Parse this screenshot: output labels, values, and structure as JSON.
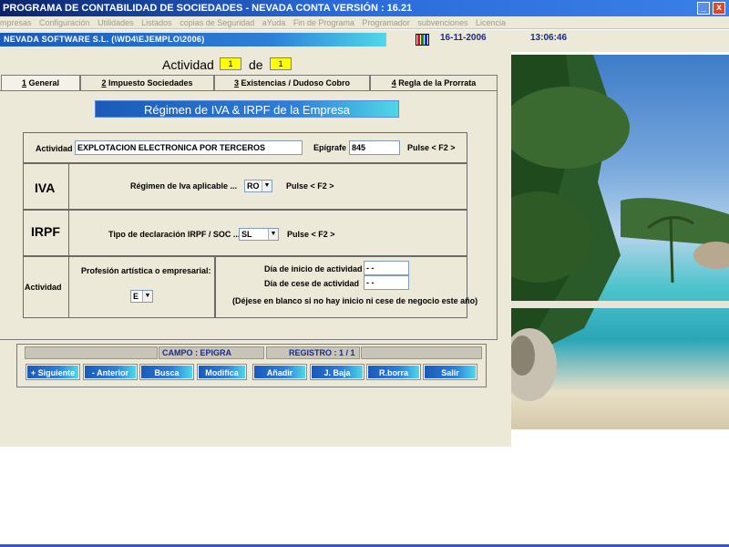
{
  "window": {
    "title": "PROGRAMA DE CONTABILIDAD DE SOCIEDADES - NEVADA CONTA  VERSIÓN : 16.21",
    "minimize": "_",
    "close": "x"
  },
  "menu": [
    "mpresas",
    "Configuración",
    "Utilidades",
    "Listados",
    "copias de Seguridad",
    "aYuda",
    "Fin de Programa",
    "Programador",
    "subvenciones",
    "Licencia"
  ],
  "status": {
    "company": "NEVADA SOFTWARE  S.L.  (\\WD4\\EJEMPLO\\2006)",
    "date": "16-11-2006",
    "time": "13:06:46"
  },
  "activity": {
    "label": "Actividad",
    "current": "1",
    "of": "de",
    "total": "1"
  },
  "tabs": [
    {
      "key": "1",
      "label": " General"
    },
    {
      "key": "2",
      "label": " Impuesto Sociedades"
    },
    {
      "key": "3",
      "label": " Existencias / Dudoso Cobro"
    },
    {
      "key": "4",
      "label": " Regla de la Prorrata"
    }
  ],
  "section_title": "Régimen de IVA & IRPF de la Empresa",
  "general": {
    "activity_label": "Actividad",
    "activity_value": "EXPLOTACION ELECTRONICA POR TERCEROS",
    "epigrafe_label": "Epígrafe",
    "epigrafe_value": "845",
    "press_hint": "Pulse  < F2 >"
  },
  "iva": {
    "heading": "IVA",
    "label": "Régimen de Iva aplicable ...",
    "value": "RO",
    "press_hint": "Pulse  < F2 >"
  },
  "irpf": {
    "heading": "IRPF",
    "label": "Tipo de declaración IRPF / SOC ...",
    "value": "SL",
    "press_hint": "Pulse  < F2 >"
  },
  "actividad": {
    "heading": "Actividad",
    "profession_label": "Profesión artística o empresarial:",
    "profession_value": "E",
    "start_label": "Día de inicio de actividad",
    "start_value": " -  - ",
    "end_label": "Día de cese de actividad",
    "end_value": " -  - ",
    "note": "(Déjese en blanco si no hay inicio ni cese de negocio este año)"
  },
  "bottom": {
    "field": "CAMPO : EPIGRA",
    "record": "REGISTRO :     1 / 1",
    "buttons": [
      "+ Siguiente",
      "- Anterior",
      "Busca",
      "Modifica",
      "Añadir",
      "J. Baja",
      "R.borra",
      "Salir"
    ]
  }
}
